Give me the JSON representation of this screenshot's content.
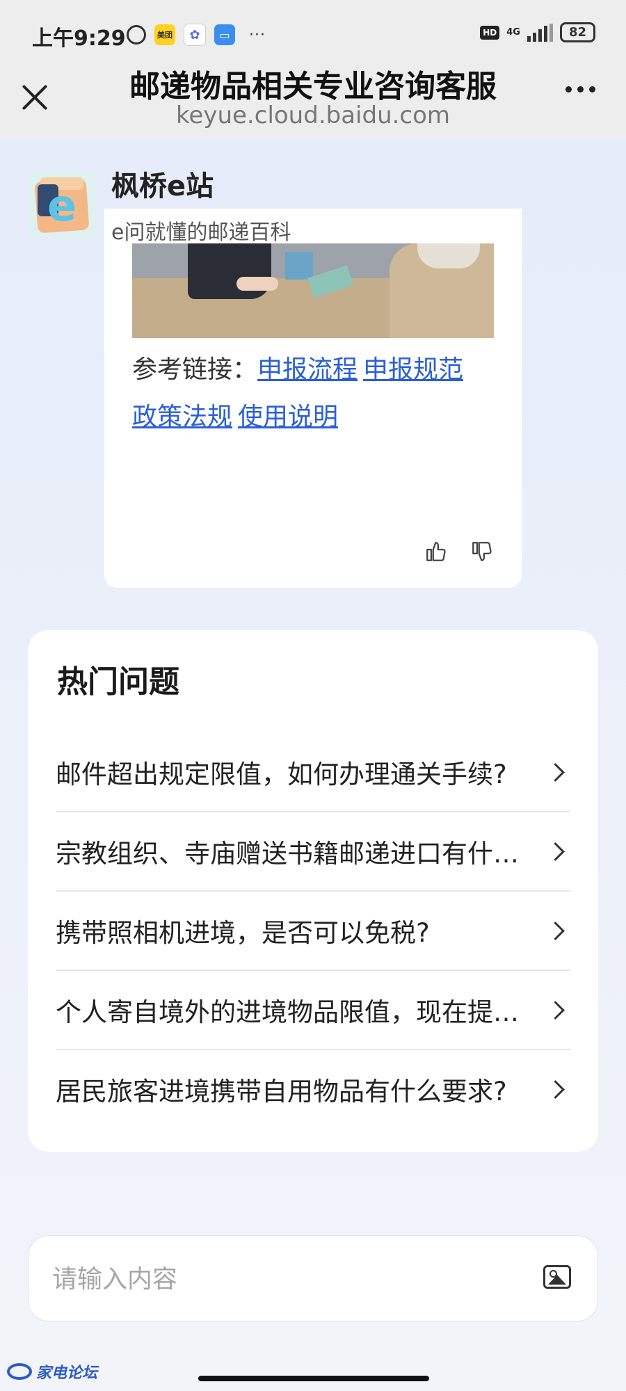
{
  "status_bar": {
    "time": "上午9:29",
    "battery": "82",
    "network": "4G",
    "hd": "HD",
    "meituan": "美团",
    "more": "···"
  },
  "title_bar": {
    "title": "邮递物品相关专业咨询客服",
    "url": "keyue.cloud.baidu.com"
  },
  "bot": {
    "name": "枫桥e站",
    "subtitle": "e问就懂的邮递百科",
    "avatar_letter": "e"
  },
  "answer": {
    "ref_label": "参考链接：",
    "links": [
      "申报流程",
      "申报规范",
      "政策法规",
      "使用说明"
    ]
  },
  "hot_questions": {
    "title": "热门问题",
    "items": [
      "邮件超出规定限值，如何办理通关手续?",
      "宗教组织、寺庙赠送书籍邮递进口有什么要求?",
      "携带照相机进境，是否可以免税?",
      "个人寄自境外的进境物品限值，现在提高到多少?",
      "居民旅客进境携带自用物品有什么要求?"
    ]
  },
  "input": {
    "placeholder": "请输入内容"
  },
  "watermark": {
    "text": "家电论坛"
  },
  "colors": {
    "link": "#2a60d6",
    "background": "#e4ebfa"
  }
}
